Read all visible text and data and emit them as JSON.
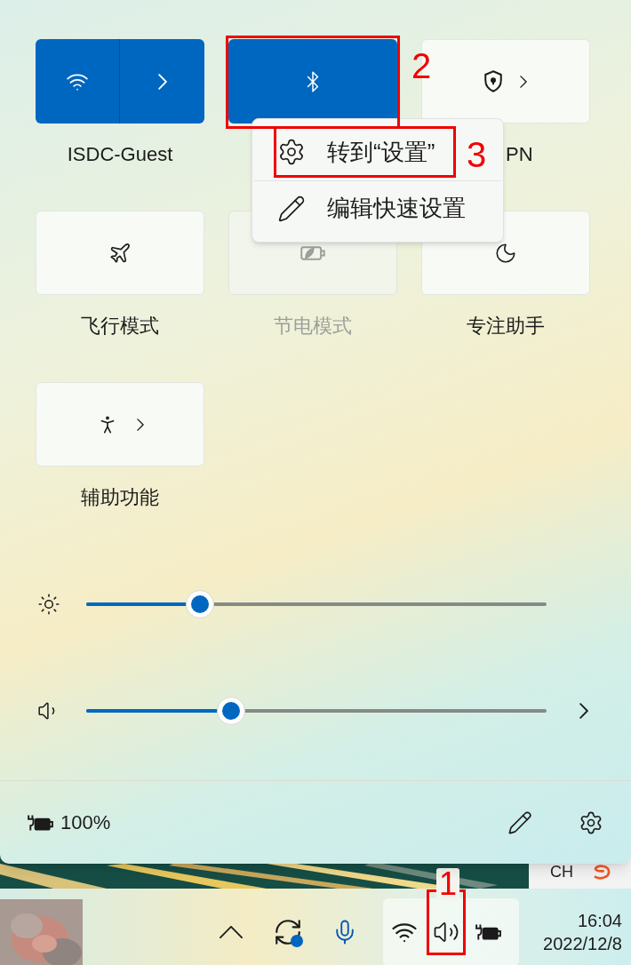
{
  "quick_settings": {
    "tiles": [
      {
        "kind": "wifi",
        "label": "ISDC-Guest",
        "on": true,
        "disabled": false
      },
      {
        "kind": "bluetooth",
        "on": true,
        "disabled": false,
        "annotation": "2"
      },
      {
        "kind": "vpn",
        "label": "PN",
        "on": false,
        "disabled": false
      },
      {
        "kind": "airplane",
        "label": "飞行模式",
        "on": false,
        "disabled": false
      },
      {
        "kind": "saver",
        "label": "节电模式",
        "on": false,
        "disabled": true
      },
      {
        "kind": "focus",
        "label": "专注助手",
        "on": false,
        "disabled": false
      },
      {
        "kind": "accessibility",
        "label": "辅助功能",
        "on": false,
        "disabled": false
      }
    ],
    "context_menu": [
      {
        "kind": "settings",
        "label": "转到“设置”",
        "annotation": "3"
      },
      {
        "kind": "edit",
        "label": "编辑快速设置"
      }
    ],
    "sliders": [
      {
        "kind": "brightness",
        "level": 0.247
      },
      {
        "kind": "volume",
        "level": 0.315
      }
    ],
    "footer": {
      "battery": "100%"
    }
  },
  "background_window": {
    "text": "CH"
  },
  "taskbar": {
    "tray": [
      {
        "kind": "overflow"
      },
      {
        "kind": "sync"
      },
      {
        "kind": "mic"
      }
    ],
    "tray_group": [
      {
        "kind": "wifi"
      },
      {
        "kind": "speaker",
        "annotation": "1"
      },
      {
        "kind": "battery"
      }
    ],
    "clock": {
      "time": "16:04",
      "date": "2022/12/8"
    }
  }
}
